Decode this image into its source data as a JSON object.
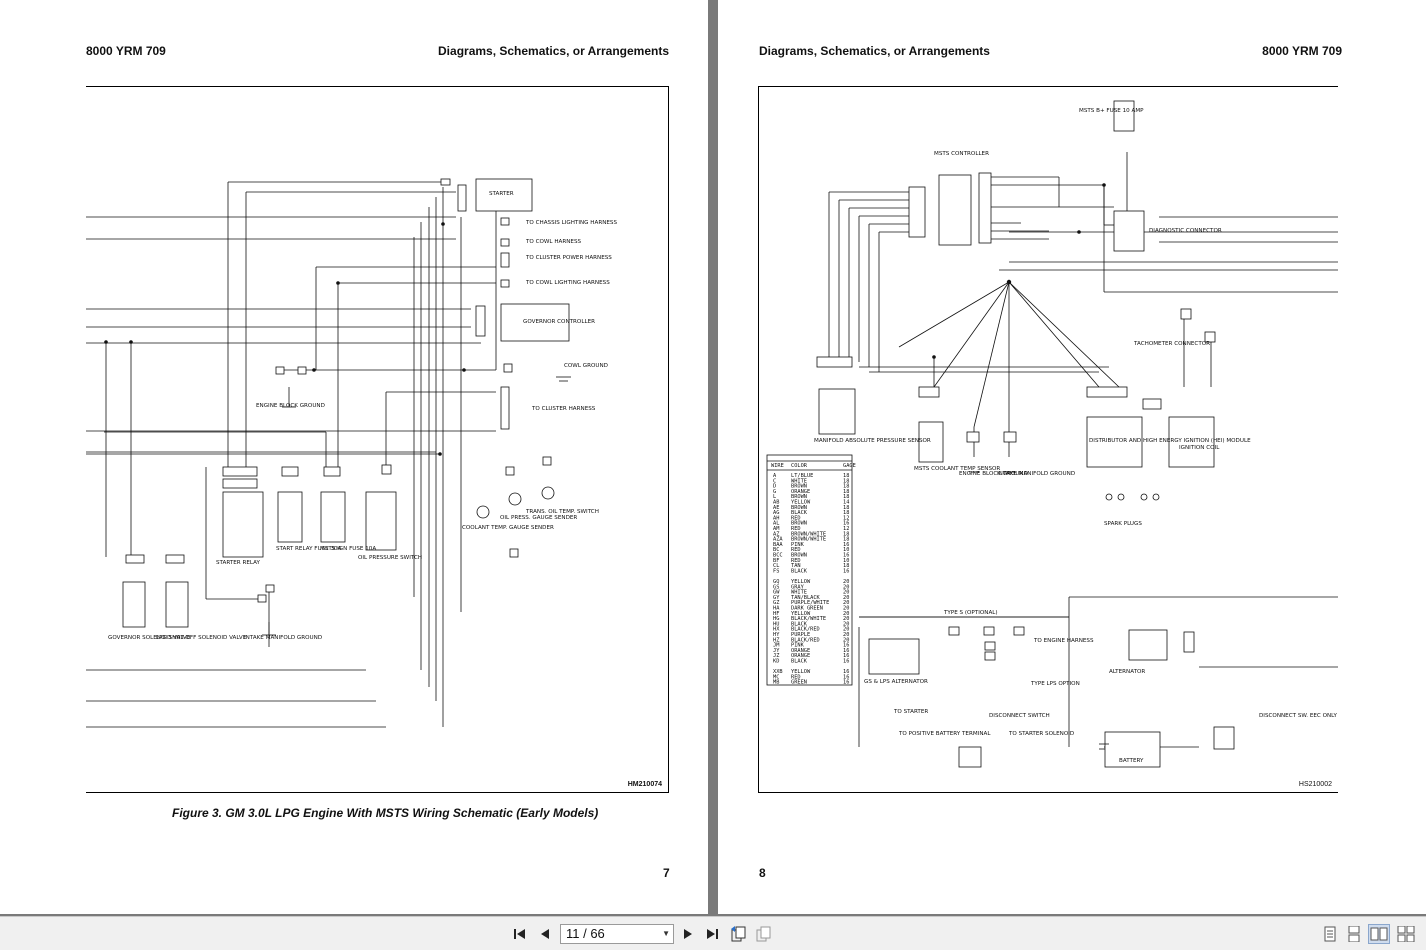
{
  "left_page": {
    "header_left": "8000 YRM 709",
    "header_right": "Diagrams, Schematics, or Arrangements",
    "figure_id": "HM210074",
    "caption": "Figure 3. GM 3.0L LPG Engine With MSTS Wiring Schematic (Early Models)",
    "page_number": "7",
    "labels": {
      "starter": "STARTER",
      "chassis": "TO CHASSIS LIGHTING HARNESS",
      "cowl": "TO COWL HARNESS",
      "cluster_power": "TO CLUSTER POWER HARNESS",
      "cowl_lighting": "TO COWL LIGHTING HARNESS",
      "governor_controller": "GOVERNOR CONTROLLER",
      "cowl_ground": "COWL GROUND",
      "engine_block_ground": "ENGINE BLOCK GROUND",
      "to_cluster_harness": "TO CLUSTER HARNESS",
      "starter_relay": "STARTER RELAY",
      "start_relay_fuse": "START RELAY FUSE 30A",
      "msts_ign_fuse": "MSTS IGN FUSE 10A",
      "oil_pressure_switch": "OIL PRESSURE SWITCH",
      "coolant_temp": "COOLANT TEMP. GAUGE SENDER",
      "oil_press_sender": "OIL PRESS. GAUGE SENDER",
      "trans_oil_temp": "TRANS. OIL TEMP. SWITCH",
      "governor_valve": "GOVERNOR SOLENOID VALVE",
      "lpg_valve": "LPG SHUT-OFF SOLENOID VALVE",
      "intake_ground": "INTAKE MANIFOLD GROUND"
    }
  },
  "right_page": {
    "header_left": "Diagrams, Schematics, or Arrangements",
    "header_right": "8000 YRM 709",
    "figure_id": "HS210002",
    "page_number": "8",
    "labels": {
      "msts_fuse": "MSTS B+ FUSE 10 AMP",
      "msts_controller": "MSTS CONTROLLER",
      "diagnostic_connector": "DIAGNOSTIC CONNECTOR",
      "tachometer": "TACHOMETER CONNECTOR",
      "manifold_sensor": "MANIFOLD ABSOLUTE PRESSURE SENSOR",
      "coolant_sensor": "MSTS COOLANT TEMP SENSOR",
      "engine_block_ground": "ENGINE BLOCK GROUND",
      "intake_ground": "INTAKE MANIFOLD GROUND",
      "distributor": "DISTRIBUTOR AND HIGH ENERGY IGNITION (HEI) MODULE",
      "ignition_coil": "IGNITION COIL",
      "spark_plugs": "SPARK PLUGS",
      "type_s": "TYPE S (OPTIONAL)",
      "to_engine_harness": "TO ENGINE HARNESS",
      "gs_lps_alternator": "GS & LPS ALTERNATOR",
      "type_lps": "TYPE LPS OPTION",
      "to_starter": "TO STARTER",
      "disconnect_switch": "DISCONNECT SWITCH",
      "to_positive": "TO POSITIVE BATTERY TERMINAL",
      "to_starter_solenoid": "TO STARTER SOLENOID",
      "alternator": "ALTERNATOR",
      "battery": "BATTERY",
      "disconnect_eec": "DISCONNECT SW. EEC ONLY"
    },
    "wire_table": {
      "headers": [
        "WIRE",
        "COLOR",
        "GAGE"
      ],
      "rows": [
        [
          "A",
          "LT/BLUE",
          "18"
        ],
        [
          "C",
          "WHITE",
          "18"
        ],
        [
          "D",
          "BROWN",
          "18"
        ],
        [
          "G",
          "ORANGE",
          "18"
        ],
        [
          "L",
          "BROWN",
          "18"
        ],
        [
          "AB",
          "YELLOW",
          "14"
        ],
        [
          "AE",
          "BROWN",
          "18"
        ],
        [
          "AG",
          "BLACK",
          "18"
        ],
        [
          "AH",
          "RED",
          "12"
        ],
        [
          "AL",
          "BROWN",
          "16"
        ],
        [
          "AM",
          "RED",
          "12"
        ],
        [
          "AZ",
          "BROWN/WHITE",
          "18"
        ],
        [
          "AZA",
          "BROWN/WHITE",
          "18"
        ],
        [
          "BAA",
          "PINK",
          "16"
        ],
        [
          "BC",
          "RED",
          "10"
        ],
        [
          "BCC",
          "BROWN",
          "16"
        ],
        [
          "BF",
          "RED",
          "10"
        ],
        [
          "CL",
          "TAN",
          "18"
        ],
        [
          "FS",
          "BLACK",
          "16"
        ],
        [
          "",
          "",
          ""
        ],
        [
          "GQ",
          "YELLOW",
          "20"
        ],
        [
          "GS",
          "GRAY",
          "20"
        ],
        [
          "GW",
          "WHITE",
          "20"
        ],
        [
          "GY",
          "TAN/BLACK",
          "20"
        ],
        [
          "GZ",
          "PURPLE/WHITE",
          "20"
        ],
        [
          "HA",
          "DARK GREEN",
          "20"
        ],
        [
          "HF",
          "YELLOW",
          "20"
        ],
        [
          "HG",
          "BLACK/WHITE",
          "20"
        ],
        [
          "HU",
          "BLACK",
          "20"
        ],
        [
          "HX",
          "BLACK/RED",
          "20"
        ],
        [
          "HY",
          "PURPLE",
          "20"
        ],
        [
          "HZ",
          "BLACK/RED",
          "20"
        ],
        [
          "JM",
          "PINK",
          "16"
        ],
        [
          "JY",
          "ORANGE",
          "16"
        ],
        [
          "JZ",
          "ORANGE",
          "16"
        ],
        [
          "KD",
          "BLACK",
          "16"
        ],
        [
          "",
          "",
          ""
        ],
        [
          "XXB",
          "YELLOW",
          "16"
        ],
        [
          "MC",
          "RED",
          "16"
        ],
        [
          "MB",
          "GREEN",
          "16"
        ]
      ]
    }
  },
  "toolbar": {
    "current_page": "11",
    "total_pages": "66",
    "page_display": "11 / 66"
  }
}
